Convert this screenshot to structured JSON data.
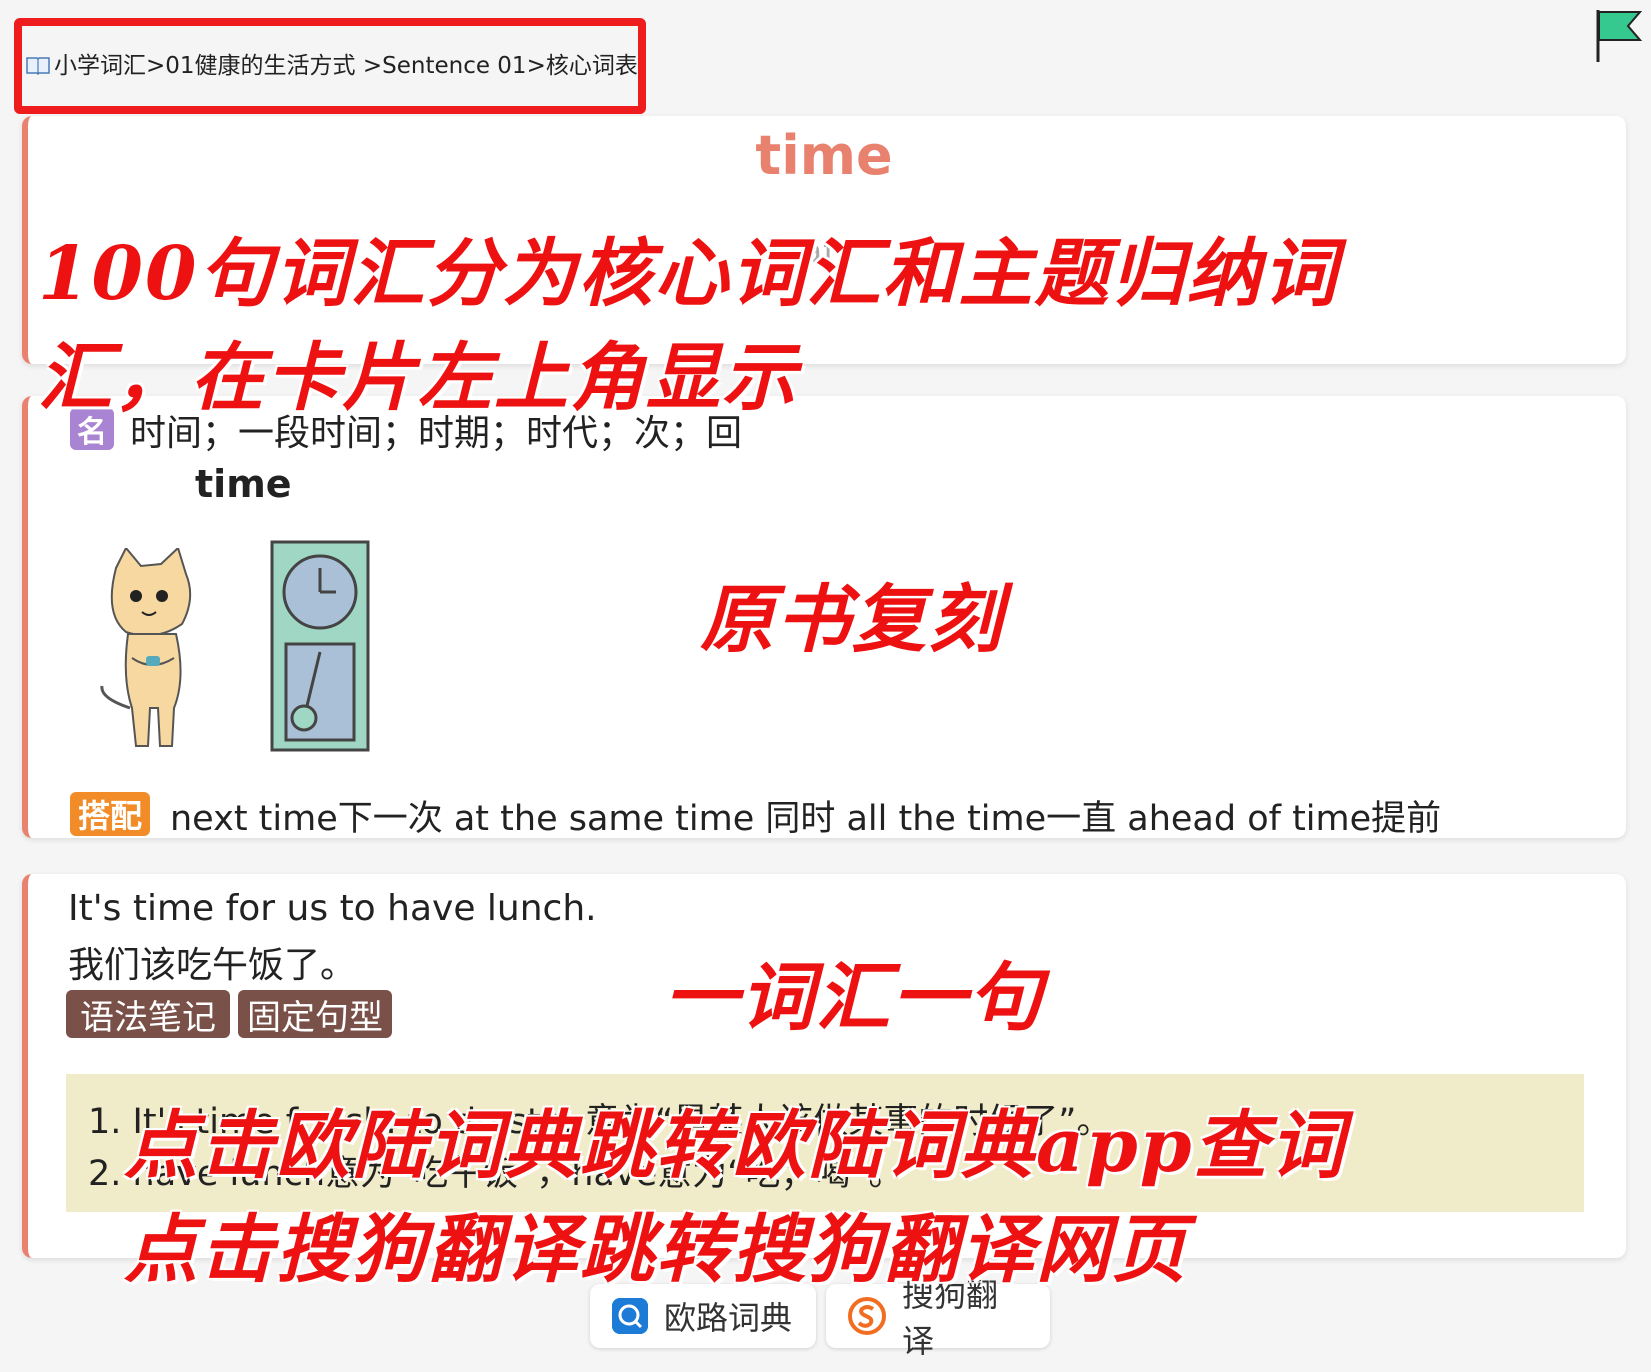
{
  "breadcrumb": {
    "text": "小学词汇>01健康的生活方式 >Sentence 01>核心词表"
  },
  "entry": {
    "headword": "time",
    "phonetic": "taɪ",
    "pos": "名",
    "meaning": "时间；一段时间；时期；时代；次；回",
    "image_title": "time",
    "collocation_label": "搭配",
    "collocations": "next time下一次 at the same time 同时 all the time一直 ahead of time提前"
  },
  "example": {
    "en": "It's time for us to have lunch.",
    "cn": "我们该吃午饭了。",
    "tags": [
      "语法笔记",
      "固定句型"
    ],
    "notes": [
      "1. It's time for sb. to do sth. 意为“是某人该做某事的时候了”。",
      "2. have lunch意为“吃午饭”，have意为“吃；喝”。"
    ]
  },
  "buttons": {
    "eudic": "欧路词典",
    "sogou": "搜狗翻译"
  },
  "annotations": {
    "a1": "100句词汇分为核心词汇和主题归纳词",
    "a2": "汇，在卡片左上角显示",
    "a3": "原书复刻",
    "a4": "一词汇一句",
    "a5": "点击欧陆词典跳转欧陆词典app查词",
    "a6": "点击搜狗翻译跳转搜狗翻译网页"
  },
  "colors": {
    "accent": "#e8826e",
    "pos_badge": "#a984d2",
    "collocation_badge": "#f28c28",
    "tag": "#7a5149",
    "notes_bg": "#f0ebc8",
    "annotation": "#ee1111"
  },
  "icons": {
    "book": "book-icon",
    "flag": "flag-icon",
    "eudic": "eudic-icon",
    "sogou": "sogou-icon"
  }
}
